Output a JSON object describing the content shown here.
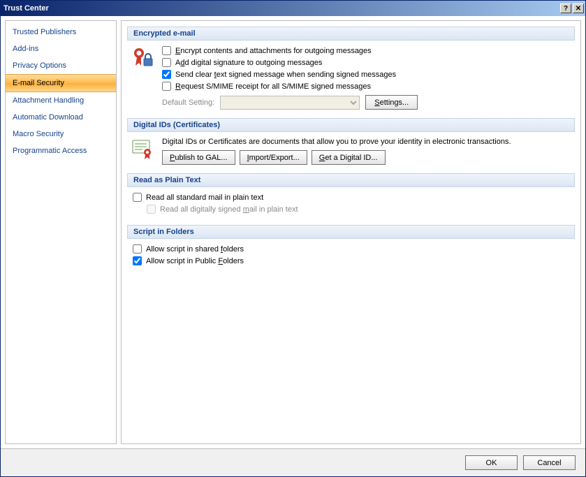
{
  "titlebar": {
    "title": "Trust Center"
  },
  "sidebar": {
    "items": [
      {
        "label": "Trusted Publishers",
        "selected": false
      },
      {
        "label": "Add-ins",
        "selected": false
      },
      {
        "label": "Privacy Options",
        "selected": false
      },
      {
        "label": "E-mail Security",
        "selected": true
      },
      {
        "label": "Attachment Handling",
        "selected": false
      },
      {
        "label": "Automatic Download",
        "selected": false
      },
      {
        "label": "Macro Security",
        "selected": false
      },
      {
        "label": "Programmatic Access",
        "selected": false
      }
    ]
  },
  "sections": {
    "encrypted": {
      "header": "Encrypted e-mail",
      "checkboxes": {
        "encrypt": {
          "label": "Encrypt contents and attachments for outgoing messages",
          "checked": false,
          "accel": "E"
        },
        "sign": {
          "label": "Add digital signature to outgoing messages",
          "checked": false,
          "accel": "d"
        },
        "cleartext": {
          "label": "Send clear text signed message when sending signed messages",
          "checked": true,
          "accel": "t"
        },
        "receipt": {
          "label": "Request S/MIME receipt for all S/MIME signed messages",
          "checked": false,
          "accel": "R"
        }
      },
      "default_setting_label": "Default Setting:",
      "default_setting_value": "",
      "settings_btn": "Settings..."
    },
    "digitalids": {
      "header": "Digital IDs (Certificates)",
      "desc": "Digital IDs or Certificates are documents that allow you to prove your identity in electronic transactions.",
      "publish_btn": "Publish to GAL...",
      "import_btn": "Import/Export...",
      "get_btn": "Get a Digital ID..."
    },
    "plaintext": {
      "header": "Read as Plain Text",
      "read_all": {
        "label": "Read all standard mail in plain text",
        "checked": false
      },
      "read_signed": {
        "label": "Read all digitally signed mail in plain text",
        "checked": false,
        "disabled": true,
        "accel": "m"
      }
    },
    "script": {
      "header": "Script in Folders",
      "shared": {
        "label": "Allow script in shared folders",
        "checked": false,
        "accel": "f"
      },
      "public": {
        "label": "Allow script in Public Folders",
        "checked": true,
        "accel": "F"
      }
    }
  },
  "footer": {
    "ok": "OK",
    "cancel": "Cancel"
  }
}
